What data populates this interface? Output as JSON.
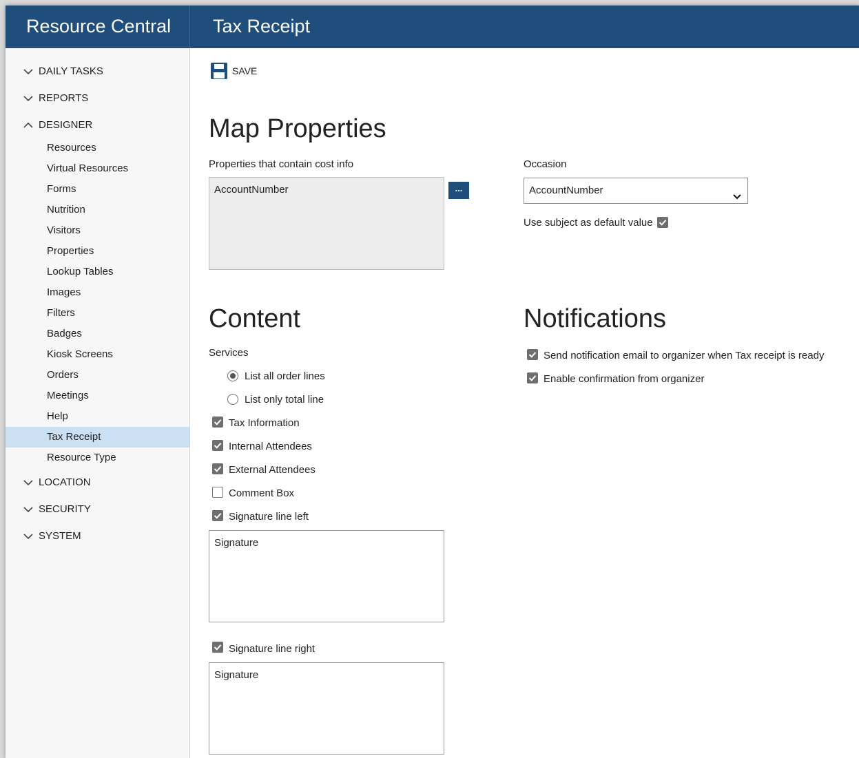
{
  "app": {
    "title": "Resource Central",
    "page_title": "Tax Receipt"
  },
  "sidebar": {
    "sections": [
      {
        "label": "DAILY TASKS",
        "expanded": false
      },
      {
        "label": "REPORTS",
        "expanded": false
      },
      {
        "label": "DESIGNER",
        "expanded": true
      },
      {
        "label": "LOCATION",
        "expanded": false
      },
      {
        "label": "SECURITY",
        "expanded": false
      },
      {
        "label": "SYSTEM",
        "expanded": false
      }
    ],
    "designer_items": [
      "Resources",
      "Virtual Resources",
      "Forms",
      "Nutrition",
      "Visitors",
      "Properties",
      "Lookup Tables",
      "Images",
      "Filters",
      "Badges",
      "Kiosk Screens",
      "Orders",
      "Meetings",
      "Help",
      "Tax Receipt",
      "Resource Type"
    ],
    "active_item": "Tax Receipt"
  },
  "toolbar": {
    "save_label": "SAVE"
  },
  "map_properties": {
    "heading": "Map Properties",
    "cost_label": "Properties that contain cost info",
    "cost_value": "AccountNumber",
    "browse_label": "...",
    "occasion_label": "Occasion",
    "occasion_value": "AccountNumber",
    "use_subject_label": "Use subject as default value",
    "use_subject_checked": true
  },
  "content": {
    "heading": "Content",
    "services_label": "Services",
    "radio_all": "List all order lines",
    "radio_total": "List only total line",
    "selected_service": "List all order lines",
    "tax_information": "Tax Information",
    "internal_attendees": "Internal Attendees",
    "external_attendees": "External Attendees",
    "comment_box": "Comment Box",
    "signature_left_label": "Signature line left",
    "signature_left_text": "Signature",
    "signature_right_label": "Signature line right",
    "signature_right_text": "Signature"
  },
  "notifications": {
    "heading": "Notifications",
    "send_email": "Send notification email to organizer when Tax receipt is ready",
    "enable_confirmation": "Enable confirmation from organizer"
  },
  "colors": {
    "header": "#1f4e7d",
    "active_nav": "#cce0f3",
    "sidebar_bg": "#f7f7f7"
  }
}
